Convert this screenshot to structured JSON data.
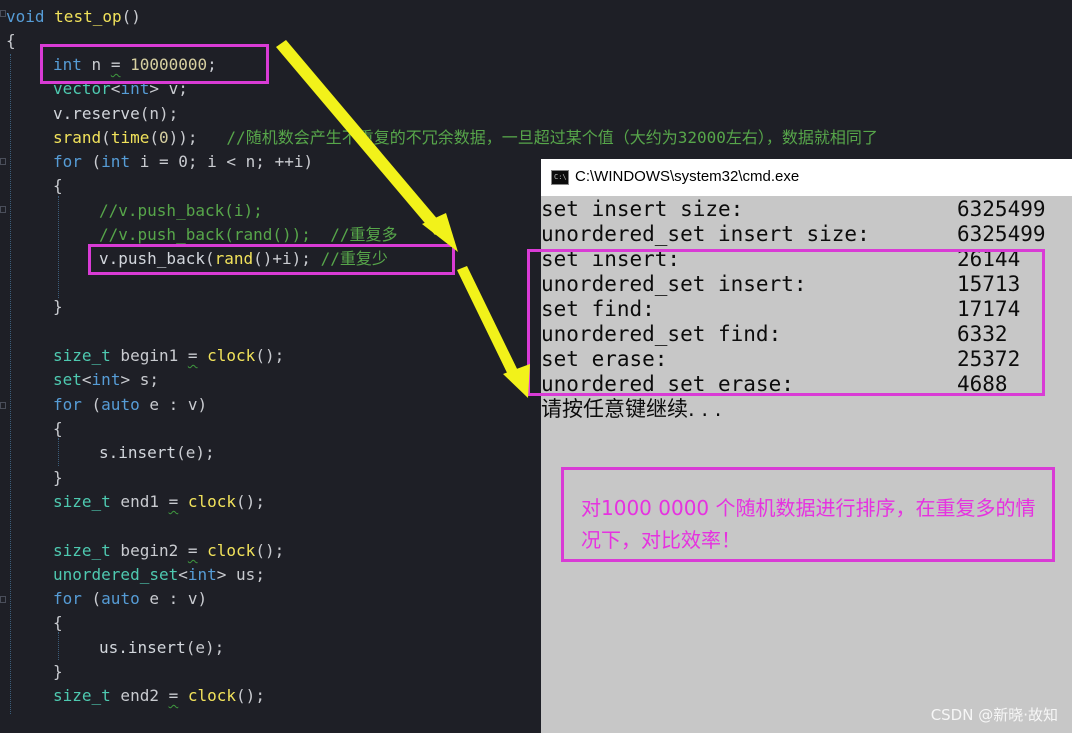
{
  "editor": {
    "lines": [
      {
        "parts": [
          [
            "kw",
            "void"
          ],
          [
            "op",
            " "
          ],
          [
            "fn",
            "test_op"
          ],
          [
            "op",
            "()"
          ]
        ]
      },
      {
        "parts": [
          [
            "op",
            "{"
          ]
        ]
      },
      {
        "parts": [
          [
            "kw",
            "int"
          ],
          [
            "op",
            " n "
          ],
          [
            "squig",
            "="
          ],
          [
            "op",
            " "
          ],
          [
            "num",
            "10000000"
          ],
          [
            "op",
            ";"
          ]
        ]
      },
      {
        "parts": [
          [
            "ty",
            "vector"
          ],
          [
            "op",
            "<"
          ],
          [
            "kw",
            "int"
          ],
          [
            "op",
            "> v;"
          ]
        ]
      },
      {
        "parts": [
          [
            "tx",
            "v.reserve"
          ],
          [
            "op",
            "(n);"
          ]
        ]
      },
      {
        "parts": [
          [
            "fn",
            "srand"
          ],
          [
            "op",
            "("
          ],
          [
            "fn",
            "time"
          ],
          [
            "op",
            "("
          ],
          [
            "num",
            "0"
          ],
          [
            "op",
            "));   "
          ],
          [
            "cm",
            "//随机数会产生不重复的不冗余数据，一旦超过某个值（大约为32000左右），数据就相同了"
          ]
        ]
      },
      {
        "parts": [
          [
            "kw",
            "for"
          ],
          [
            "op",
            " ("
          ],
          [
            "kw",
            "int"
          ],
          [
            "op",
            " i = 0; i < n; ++i)"
          ]
        ]
      },
      {
        "parts": [
          [
            "op",
            "{"
          ]
        ]
      },
      {
        "parts": [
          [
            "cm",
            "//v.push_back(i);"
          ]
        ]
      },
      {
        "parts": [
          [
            "cm",
            "//v.push_back(rand());  //重复多"
          ]
        ]
      },
      {
        "parts": [
          [
            "tx",
            "v.push_back"
          ],
          [
            "op",
            "("
          ],
          [
            "fn",
            "rand"
          ],
          [
            "op",
            "()+i); "
          ],
          [
            "cm",
            "//重复少"
          ]
        ]
      },
      {
        "parts": [
          [
            "op",
            ""
          ]
        ]
      },
      {
        "parts": [
          [
            "op",
            "}"
          ]
        ]
      },
      {
        "parts": [
          [
            "op",
            ""
          ]
        ]
      },
      {
        "parts": [
          [
            "ty",
            "size_t"
          ],
          [
            "op",
            " begin1 "
          ],
          [
            "squig",
            "="
          ],
          [
            "op",
            " "
          ],
          [
            "fn",
            "clock"
          ],
          [
            "op",
            "();"
          ]
        ]
      },
      {
        "parts": [
          [
            "ty",
            "set"
          ],
          [
            "op",
            "<"
          ],
          [
            "kw",
            "int"
          ],
          [
            "op",
            "> s;"
          ]
        ]
      },
      {
        "parts": [
          [
            "kw",
            "for"
          ],
          [
            "op",
            " ("
          ],
          [
            "kw",
            "auto"
          ],
          [
            "op",
            " e : v)"
          ]
        ]
      },
      {
        "parts": [
          [
            "op",
            "{"
          ]
        ]
      },
      {
        "parts": [
          [
            "tx",
            "s.insert"
          ],
          [
            "op",
            "(e);"
          ]
        ]
      },
      {
        "parts": [
          [
            "op",
            "}"
          ]
        ]
      },
      {
        "parts": [
          [
            "ty",
            "size_t"
          ],
          [
            "op",
            " end1 "
          ],
          [
            "squig",
            "="
          ],
          [
            "op",
            " "
          ],
          [
            "fn",
            "clock"
          ],
          [
            "op",
            "();"
          ]
        ]
      },
      {
        "parts": [
          [
            "op",
            ""
          ]
        ]
      },
      {
        "parts": [
          [
            "ty",
            "size_t"
          ],
          [
            "op",
            " begin2 "
          ],
          [
            "squig",
            "="
          ],
          [
            "op",
            " "
          ],
          [
            "fn",
            "clock"
          ],
          [
            "op",
            "();"
          ]
        ]
      },
      {
        "parts": [
          [
            "ty",
            "unordered_set"
          ],
          [
            "op",
            "<"
          ],
          [
            "kw",
            "int"
          ],
          [
            "op",
            "> us;"
          ]
        ]
      },
      {
        "parts": [
          [
            "kw",
            "for"
          ],
          [
            "op",
            " ("
          ],
          [
            "kw",
            "auto"
          ],
          [
            "op",
            " e : v)"
          ]
        ]
      },
      {
        "parts": [
          [
            "op",
            "{"
          ]
        ]
      },
      {
        "parts": [
          [
            "tx",
            "us.insert"
          ],
          [
            "op",
            "(e);"
          ]
        ]
      },
      {
        "parts": [
          [
            "op",
            "}"
          ]
        ]
      },
      {
        "parts": [
          [
            "ty",
            "size_t"
          ],
          [
            "op",
            " end2 "
          ],
          [
            "squig",
            "="
          ],
          [
            "op",
            " "
          ],
          [
            "fn",
            "clock"
          ],
          [
            "op",
            "();"
          ]
        ]
      }
    ]
  },
  "console": {
    "title": "C:\\WINDOWS\\system32\\cmd.exe",
    "rows": [
      {
        "label": "set insert size:",
        "value": "6325499"
      },
      {
        "label": "unordered_set insert size:",
        "value": "6325499"
      },
      {
        "label": "set insert:",
        "value": "26144"
      },
      {
        "label": "unordered_set insert:",
        "value": "15713"
      },
      {
        "label": "set find:",
        "value": "17174"
      },
      {
        "label": "unordered_set find:",
        "value": "6332"
      },
      {
        "label": "set erase:",
        "value": "25372"
      },
      {
        "label": "unordered_set erase:",
        "value": "4688"
      }
    ],
    "prompt": "请按任意键继续. . ."
  },
  "note": {
    "text": "对1000 0000 个随机数据进行排序，在重复多的情况下，对比效率！"
  },
  "watermark": "CSDN @新晓·故知",
  "colors": {
    "highlight_box": "#d93bd5",
    "arrow": "#f2f21a",
    "note_text": "#e632e0",
    "console_bg": "#c7c7c7",
    "editor_bg": "#1e1f26"
  }
}
